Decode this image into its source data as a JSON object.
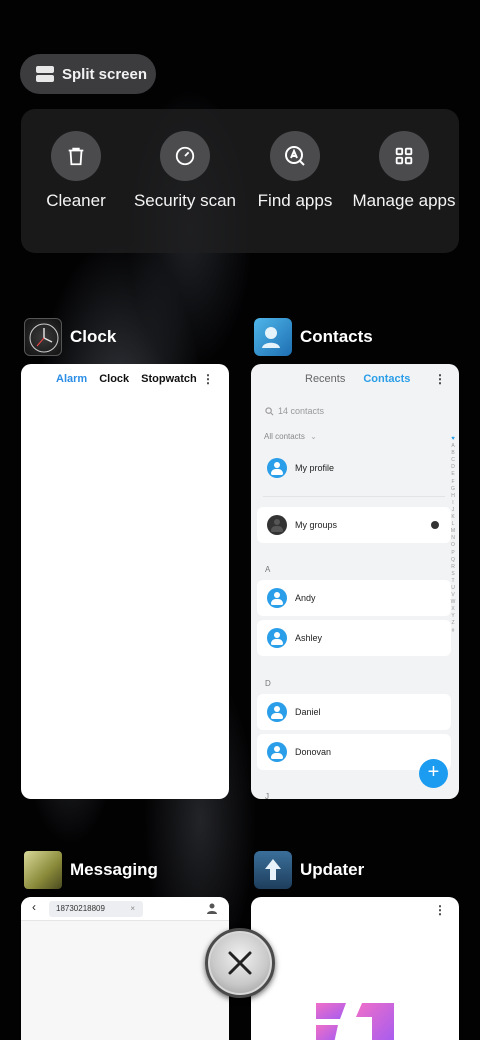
{
  "split_screen": {
    "label": "Split screen"
  },
  "tools": [
    {
      "label": "Cleaner",
      "icon": "trash-icon"
    },
    {
      "label": "Security scan",
      "icon": "gauge-icon"
    },
    {
      "label": "Find apps",
      "icon": "search-a-icon"
    },
    {
      "label": "Manage apps",
      "icon": "grid-icon"
    }
  ],
  "apps": {
    "clock": {
      "name": "Clock",
      "tabs": [
        "Alarm",
        "Clock",
        "Stopwatch"
      ]
    },
    "contacts": {
      "name": "Contacts",
      "tabs": [
        "Recents",
        "Contacts"
      ],
      "search_placeholder": "14 contacts",
      "filter": "All contacts",
      "my_profile": "My profile",
      "my_groups": "My groups",
      "sections": [
        {
          "letter": "A",
          "names": [
            "Andy",
            "Ashley"
          ]
        },
        {
          "letter": "D",
          "names": [
            "Daniel",
            "Donovan"
          ]
        }
      ],
      "index_letters": [
        "A",
        "B",
        "C",
        "D",
        "E",
        "F",
        "G",
        "H",
        "I",
        "J",
        "K",
        "L",
        "M",
        "N",
        "O",
        "P",
        "Q",
        "R",
        "S",
        "T",
        "U",
        "V",
        "W",
        "X",
        "Y",
        "Z",
        "#"
      ],
      "next_letter": "J"
    },
    "messaging": {
      "name": "Messaging",
      "recipient": "18730218809"
    },
    "updater": {
      "name": "Updater"
    }
  },
  "colors": {
    "accent_blue": "#2a9ee8",
    "card_bg": "#ffffff"
  }
}
